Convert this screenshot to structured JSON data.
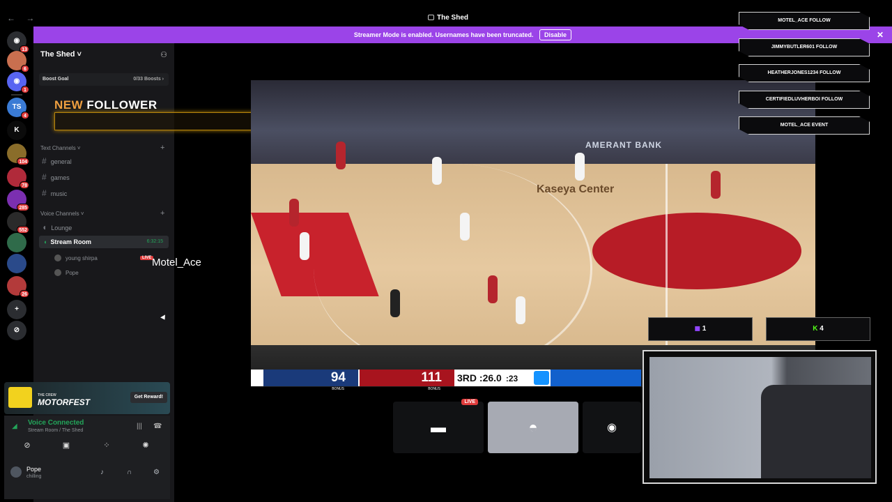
{
  "window": {
    "title": "The Shed",
    "nav": "← →"
  },
  "streamer_bar": {
    "text": "Streamer Mode is enabled. Usernames have been truncated.",
    "button": "Disable",
    "close": "✕"
  },
  "rail": {
    "items": [
      {
        "label": "◉",
        "badge": "13",
        "color": "#2b2d31"
      },
      {
        "label": "",
        "badge": "6",
        "color": "#c96f4f"
      },
      {
        "label": "◉",
        "badge": "1",
        "color": "#5865f2"
      },
      {
        "label": "TS",
        "badge": "4",
        "color": "#3a7bd5"
      },
      {
        "label": "K",
        "badge": "",
        "color": "#0b0b0b"
      },
      {
        "label": "",
        "badge": "104",
        "color": "#8a6d2a"
      },
      {
        "label": "",
        "badge": "78",
        "color": "#b02a3a"
      },
      {
        "label": "",
        "badge": "285",
        "color": "#7b2fb0"
      },
      {
        "label": "",
        "badge": "552",
        "color": "#2a2a2a"
      },
      {
        "label": "",
        "badge": "",
        "color": "#2f6b4a"
      },
      {
        "label": "",
        "badge": "",
        "color": "#2a4a8a"
      },
      {
        "label": "",
        "badge": "26",
        "color": "#b33a3a"
      },
      {
        "label": "+",
        "badge": "",
        "color": "#2b2d31"
      },
      {
        "label": "⊘",
        "badge": "",
        "color": "#2b2d31"
      }
    ]
  },
  "sidebar": {
    "server_name": "The Shed ˅",
    "boost": {
      "label": "Boost Goal",
      "count": "0/33 Boosts ›"
    },
    "text_category": "Text Channels ˅",
    "text_channels": [
      "general",
      "games",
      "music"
    ],
    "voice_category": "Voice Channels ˅",
    "voice_channels": [
      "Lounge"
    ],
    "active_voice": {
      "name": "Stream Room",
      "time": "6:32:15"
    },
    "voice_users": [
      {
        "name": "young shirpa",
        "live": "LIVE"
      },
      {
        "name": "Pope",
        "live": ""
      }
    ]
  },
  "follower_overlay": {
    "title_a": "NEW ",
    "title_b": "FOLLOWER"
  },
  "stream_label": "Motel_Ace",
  "promo": {
    "small": "THE CREW",
    "title": "MOTORFEST",
    "cta": "Get Reward!"
  },
  "voice_connected": {
    "status": "Voice Connected",
    "channel": "Stream Room / The Shed"
  },
  "user": {
    "name": "Pope",
    "status": "chilling"
  },
  "scoreboard": {
    "team1_score": "94",
    "team2_score": "111",
    "bonus": "BONUS",
    "quarter": "3RD",
    "clock": ":26.0",
    "shot_clock": ":23",
    "colors": {
      "team1": "#1a3a7a",
      "team2": "#a8141e"
    }
  },
  "arena": {
    "sign": "AMERANT BANK",
    "center_text": "Kaseya Center"
  },
  "tiles": {
    "live": "LIVE"
  },
  "alerts": [
    "MOTEL_ACE FOLLOW",
    "JIMMYBUTLER601 FOLLOW",
    "HEATHERJONES1234 FOLLOW",
    "CERTIFIEDLUVHERBOI FOLLOW",
    "MOTEL_ACE EVENT"
  ],
  "polls": [
    {
      "label": "1",
      "color": "#9146ff"
    },
    {
      "label": "4",
      "color": "#53fc18"
    }
  ]
}
